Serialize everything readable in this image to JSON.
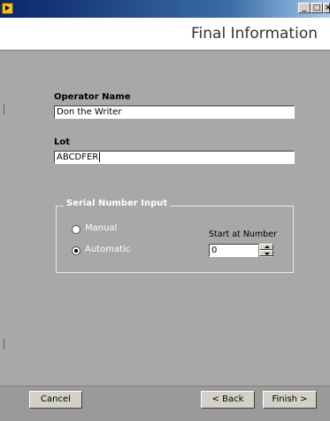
{
  "window": {
    "caption_buttons": {
      "minimize": "_",
      "maximize": "□",
      "close": "×"
    }
  },
  "header": {
    "title": "Final Information"
  },
  "form": {
    "operator_name": {
      "label": "Operator Name",
      "value": "Don the Writer"
    },
    "lot": {
      "label": "Lot",
      "value": "ABCDFER"
    }
  },
  "serial_number_input": {
    "legend": "Serial Number Input",
    "options": [
      {
        "label": "Manual",
        "selected": false
      },
      {
        "label": "Automatic",
        "selected": true
      }
    ],
    "start_at_number": {
      "label": "Start at Number",
      "value": "0"
    }
  },
  "footer": {
    "cancel_label": "Cancel",
    "back_label": "< Back",
    "finish_label": "Finish >"
  },
  "colors": {
    "content_bg": "#a8a8a8",
    "footer_bg": "#9a9a9a",
    "titlebar_start": "#0a246a",
    "titlebar_end": "#a6caf0",
    "button_face": "#d4d0c8"
  },
  "icons": [
    "app-icon",
    "minimize-icon",
    "maximize-icon",
    "close-icon",
    "spin-up-icon",
    "spin-down-icon"
  ]
}
